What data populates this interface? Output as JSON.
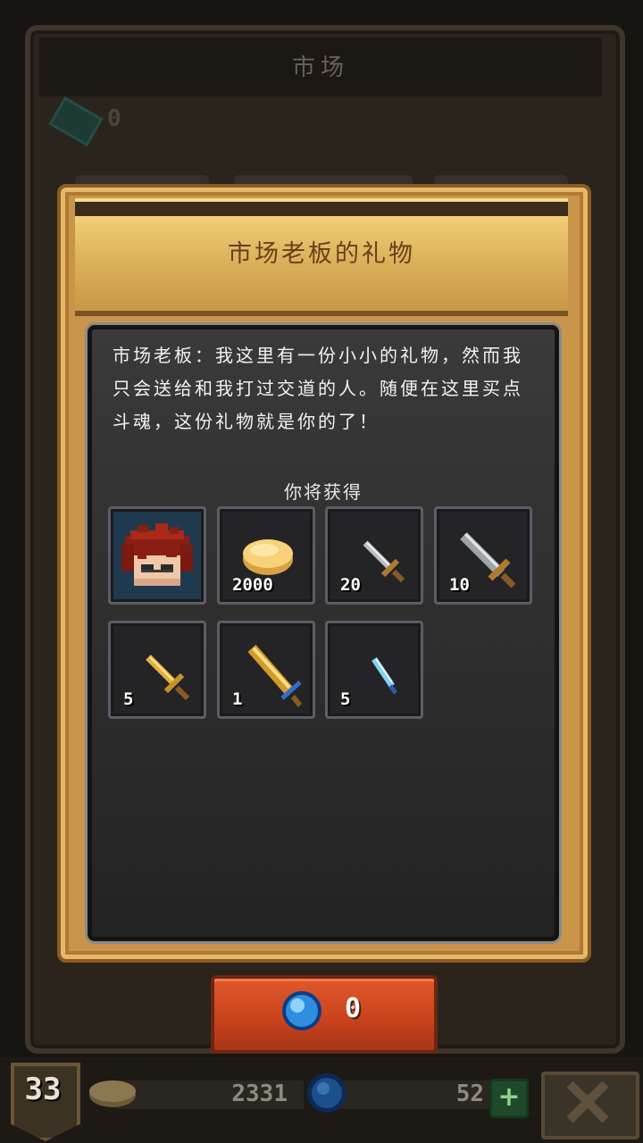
{
  "background": {
    "title": "市场",
    "ticket_count": "0"
  },
  "dialog": {
    "title": "市场老板的礼物",
    "message": "市场老板：我这里有一份小小的礼物，然而我只会送给和我打过交道的人。随便在这里买点斗魂，这份礼物就是你的了！",
    "reward_heading": "你将获得",
    "rewards": [
      {
        "icon": "hero-portrait-icon",
        "count": ""
      },
      {
        "icon": "gold-coin-icon",
        "count": "2000"
      },
      {
        "icon": "small-iron-sword-icon",
        "count": "20"
      },
      {
        "icon": "large-iron-sword-icon",
        "count": "10"
      },
      {
        "icon": "gold-sword-icon",
        "count": "5"
      },
      {
        "icon": "legendary-gold-sword-icon",
        "count": "1"
      },
      {
        "icon": "crystal-dagger-icon",
        "count": "5"
      }
    ]
  },
  "buy_button": {
    "icon": "blue-gem-icon",
    "price": "0"
  },
  "status_bar": {
    "level": "33",
    "gold": "2331",
    "gems": "52",
    "add_label": "+"
  },
  "colors": {
    "dialog_gold": "#c9954a",
    "header_gold": "#ddb25c",
    "button_red": "#c8421c",
    "gem_blue": "#2f8ee0"
  }
}
